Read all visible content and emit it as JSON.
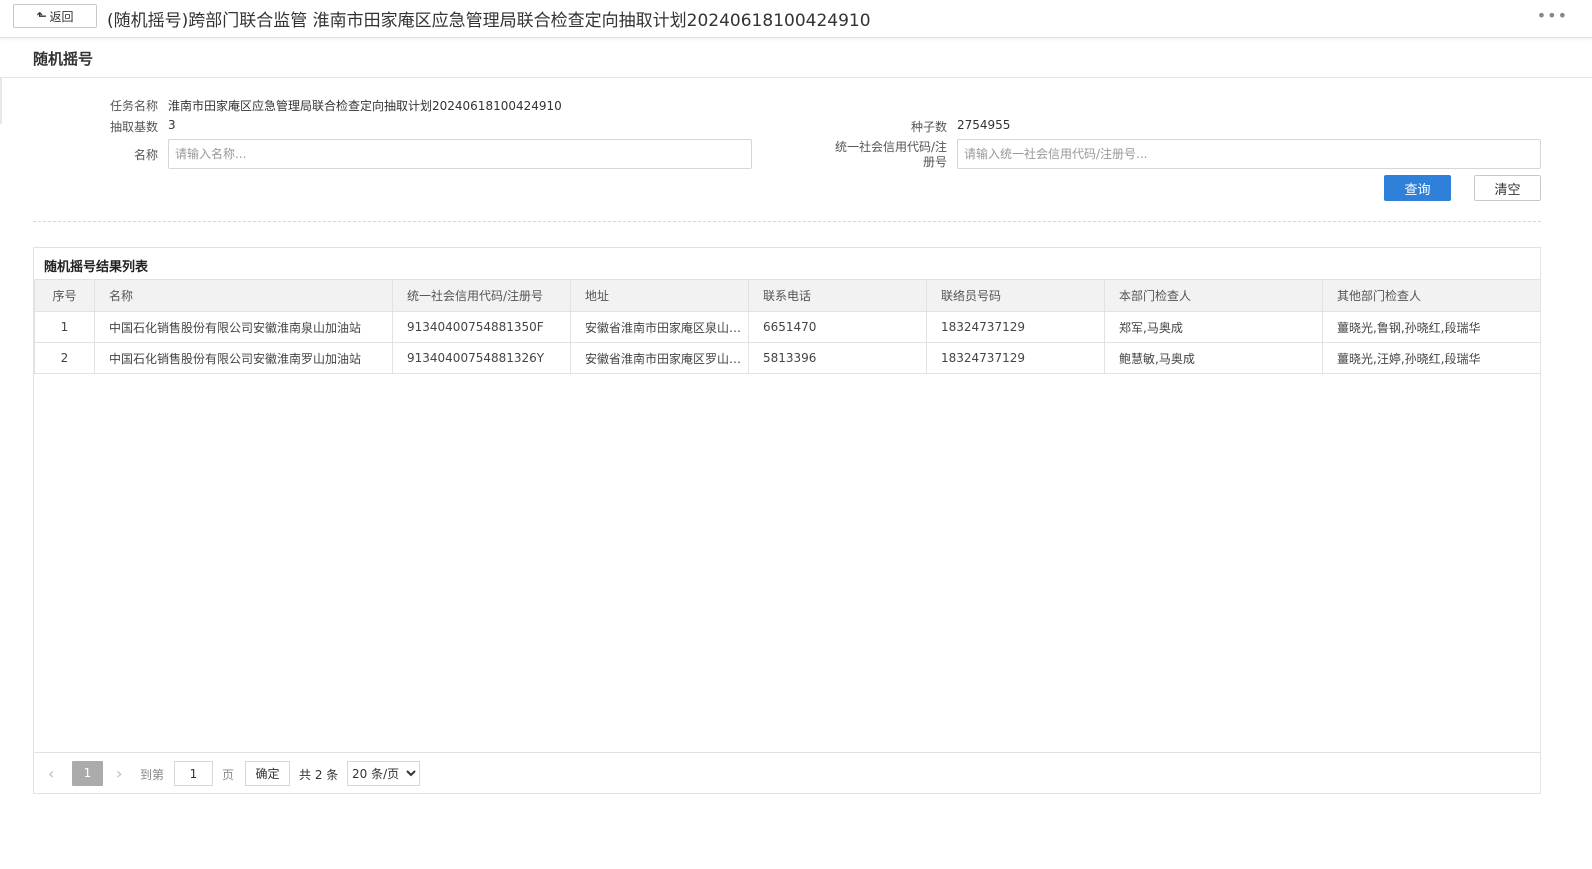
{
  "header": {
    "back_label": "返回",
    "title": "(随机摇号)跨部门联合监管 淮南市田家庵区应急管理局联合检查定向抽取计划20240618100424910"
  },
  "section_title": "随机摇号",
  "form": {
    "task_name_label": "任务名称",
    "task_name_value": "淮南市田家庵区应急管理局联合检查定向抽取计划20240618100424910",
    "base_count_label": "抽取基数",
    "base_count_value": "3",
    "seed_label": "种子数",
    "seed_value": "2754955",
    "name_label": "名称",
    "name_placeholder": "请输入名称...",
    "credit_label_1": "统一社会信用代码/注",
    "credit_label_2": "册号",
    "credit_placeholder": "请输入统一社会信用代码/注册号...",
    "query_button": "查询",
    "clear_button": "清空"
  },
  "results": {
    "title": "随机摇号结果列表",
    "columns": [
      "序号",
      "名称",
      "统一社会信用代码/注册号",
      "地址",
      "联系电话",
      "联络员号码",
      "本部门检查人",
      "其他部门检查人"
    ],
    "rows": [
      {
        "index": "1",
        "name": "中国石化销售股份有限公司安徽淮南泉山加油站",
        "credit_code": "91340400754881350F",
        "address": "安徽省淮南市田家庵区泉山加油站",
        "phone": "6651470",
        "liaison_phone": "18324737129",
        "dept_inspectors": "郑军,马奥成",
        "other_inspectors": "薑晓光,鲁钢,孙晓红,段瑞华"
      },
      {
        "index": "2",
        "name": "中国石化销售股份有限公司安徽淮南罗山加油站",
        "credit_code": "91340400754881326Y",
        "address": "安徽省淮南市田家庵区罗山加油站",
        "phone": "5813396",
        "liaison_phone": "18324737129",
        "dept_inspectors": "鲍慧敏,马奥成",
        "other_inspectors": "薑晓光,汪婷,孙晓红,段瑞华"
      }
    ]
  },
  "pager": {
    "current_page": "1",
    "goto_label": "到第",
    "goto_value": "1",
    "page_label": "页",
    "confirm_label": "确定",
    "total_label": "共 2 条",
    "page_size": "20 条/页"
  }
}
